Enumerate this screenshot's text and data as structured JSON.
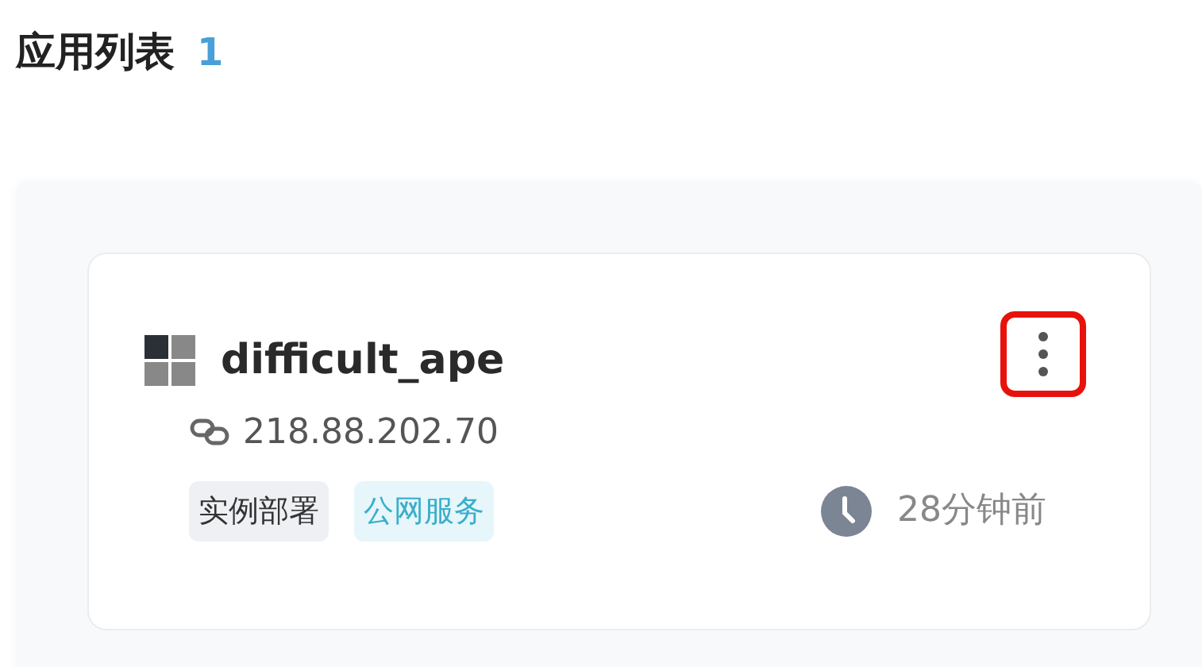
{
  "header": {
    "title": "应用列表",
    "count": "1"
  },
  "apps": [
    {
      "name": "difficult_ape",
      "address": "218.88.202.70",
      "tags": [
        {
          "label": "实例部署",
          "kind": "neutral"
        },
        {
          "label": "公网服务",
          "kind": "info"
        }
      ],
      "time": "28分钟前",
      "menu": {
        "highlighted": true
      }
    }
  ]
}
